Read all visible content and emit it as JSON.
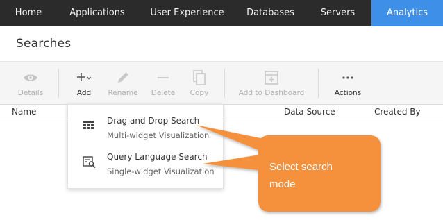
{
  "nav": {
    "items": [
      "Home",
      "Applications",
      "User Experience",
      "Databases",
      "Servers",
      "Analytics"
    ],
    "active_index": 5,
    "active_color": "#3d8fe8",
    "background": "#2b2b2b"
  },
  "page": {
    "title": "Searches"
  },
  "toolbar": {
    "details": {
      "label": "Details",
      "icon": "eye-icon"
    },
    "add": {
      "label": "Add",
      "icon": "plus-chevron-icon"
    },
    "rename": {
      "label": "Rename",
      "icon": "pencil-icon"
    },
    "delete": {
      "label": "Delete",
      "icon": "minus-icon"
    },
    "copy": {
      "label": "Copy",
      "icon": "copy-icon"
    },
    "add_to_dashboard": {
      "label": "Add to Dashboard",
      "icon": "dashboard-add-icon"
    },
    "actions": {
      "label": "Actions",
      "icon": "ellipsis-icon"
    }
  },
  "table": {
    "columns": [
      "Name",
      "Data Source",
      "Created By"
    ]
  },
  "add_menu": {
    "items": [
      {
        "title": "Drag and Drop Search",
        "subtitle": "Multi-widget Visualization",
        "icon": "table-grid-icon"
      },
      {
        "title": "Query Language Search",
        "subtitle": "Single-widget Visualization",
        "icon": "query-search-icon"
      }
    ]
  },
  "callout": {
    "line1": "Select search",
    "line2": "mode",
    "color": "#f5913d"
  }
}
